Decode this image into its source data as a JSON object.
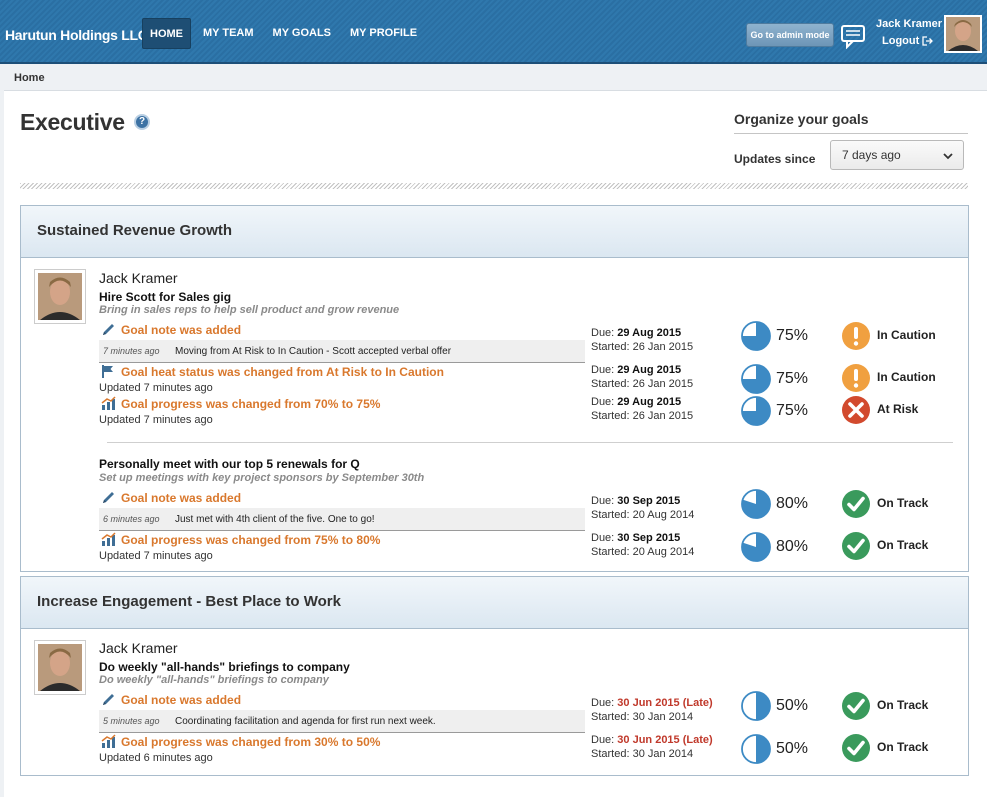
{
  "header": {
    "brand": "Harutun Holdings LLC",
    "nav": [
      "HOME",
      "MY TEAM",
      "MY GOALS",
      "MY PROFILE"
    ],
    "admin_button": "Go to admin mode",
    "user_name": "Jack Kramer",
    "logout": "Logout"
  },
  "breadcrumb": "Home",
  "page": {
    "title": "Executive",
    "help": "?",
    "organize_title": "Organize your goals",
    "updates_since_label": "Updates since",
    "updates_since_value": "7 days ago"
  },
  "sections": [
    {
      "title": "Sustained Revenue Growth",
      "person": "Jack Kramer",
      "goals": [
        {
          "title": "Hire Scott for Sales gig",
          "desc": "Bring in sales reps to help sell product and grow revenue",
          "events": [
            {
              "icon": "pencil-icon",
              "text": "Goal note was added",
              "note_ago": "7 minutes ago",
              "note": "Moving from At Risk to In Caution - Scott accepted verbal offer",
              "due": "29 Aug 2015",
              "started": "Started: 26 Jan 2015",
              "percent": 75,
              "percent_label": "75%",
              "status": "In Caution",
              "status_type": "caution"
            },
            {
              "icon": "flag-icon",
              "text": "Goal heat status was changed from At Risk to In Caution",
              "updated": "Updated 7 minutes ago",
              "due": "29 Aug 2015",
              "started": "Started: 26 Jan 2015",
              "percent": 75,
              "percent_label": "75%",
              "status": "In Caution",
              "status_type": "caution"
            },
            {
              "icon": "progress-chart-icon",
              "text": "Goal progress was changed from 70% to 75%",
              "updated": "Updated 7 minutes ago",
              "due": "29 Aug 2015",
              "started": "Started: 26 Jan 2015",
              "percent": 75,
              "percent_label": "75%",
              "status": "At Risk",
              "status_type": "risk"
            }
          ]
        },
        {
          "title": "Personally meet with our top 5 renewals for Q",
          "desc": "Set up meetings with key project sponsors by September 30th",
          "events": [
            {
              "icon": "pencil-icon",
              "text": "Goal note was added",
              "note_ago": "6 minutes ago",
              "note": "Just met with 4th client of the five. One to go!",
              "due": "30 Sep 2015",
              "started": "Started: 20 Aug 2014",
              "percent": 80,
              "percent_label": "80%",
              "status": "On Track",
              "status_type": "ok"
            },
            {
              "icon": "progress-chart-icon",
              "text": "Goal progress was changed from 75% to 80%",
              "updated": "Updated 7 minutes ago",
              "due": "30 Sep 2015",
              "started": "Started: 20 Aug 2014",
              "percent": 80,
              "percent_label": "80%",
              "status": "On Track",
              "status_type": "ok"
            }
          ]
        }
      ]
    },
    {
      "title": "Increase Engagement - Best Place to Work",
      "person": "Jack Kramer",
      "goals": [
        {
          "title": "Do weekly \"all-hands\" briefings to company",
          "desc": "Do weekly \"all-hands\" briefings to company",
          "events": [
            {
              "icon": "pencil-icon",
              "text": "Goal note was added",
              "note_ago": "5 minutes ago",
              "note": "Coordinating facilitation and agenda for first run next week.",
              "due": "30 Jun 2015 (Late)",
              "started": "Started: 30 Jan 2014",
              "percent": 50,
              "percent_label": "50%",
              "status": "On Track",
              "status_type": "ok"
            },
            {
              "icon": "progress-chart-icon",
              "text": "Goal progress was changed from 30% to 50%",
              "updated": "Updated 6 minutes ago",
              "due": "30 Jun 2015 (Late)",
              "started": "Started: 30 Jan 2014",
              "percent": 50,
              "percent_label": "50%",
              "status": "On Track",
              "status_type": "ok"
            }
          ]
        }
      ]
    }
  ],
  "labels": {
    "due_prefix": "Due: "
  },
  "colors": {
    "accent_orange": "#d9782d",
    "pie_blue": "#3d8ac4",
    "caution": "#f0a040",
    "risk": "#d24a2e",
    "ok": "#3a9a5c",
    "late": "#c0392b"
  }
}
